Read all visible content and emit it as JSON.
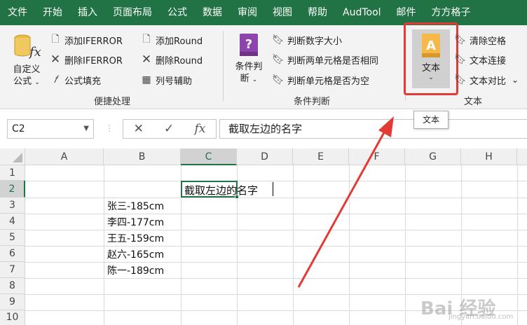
{
  "menu": [
    "文件",
    "开始",
    "插入",
    "页面布局",
    "公式",
    "数据",
    "审阅",
    "视图",
    "帮助",
    "AudTool",
    "邮件",
    "方方格子"
  ],
  "ribbon": {
    "custom_formula": {
      "line1": "自定义",
      "line2": "公式"
    },
    "quick": {
      "add_iferror": "添加IFERROR",
      "del_iferror": "删除IFERROR",
      "fill_formula": "公式填充",
      "add_round": "添加Round",
      "del_round": "删除Round",
      "col_helper": "列号辅助",
      "group_label": "便捷处理"
    },
    "condition": {
      "btn_line1": "条件判",
      "btn_line2": "断",
      "judge_size": "判断数字大小",
      "judge_same": "判断两单元格是否相同",
      "judge_empty": "判断单元格是否为空",
      "group_label": "条件判断"
    },
    "text": {
      "btn_label": "文本",
      "clear_space": "清除空格",
      "text_concat": "文本连接",
      "text_compare": "文本对比",
      "group_label": "文本"
    },
    "highlight_color": "#e53935",
    "accent_color": "#217346"
  },
  "tooltip": "文本",
  "formula_bar": {
    "name_box": "C2",
    "cancel_symbol": "✕",
    "confirm_symbol": "✓",
    "fx_symbol": "fx",
    "content": "截取左边的名字"
  },
  "grid": {
    "columns": [
      "A",
      "B",
      "C",
      "D",
      "E",
      "F",
      "G",
      "H"
    ],
    "rows": [
      "1",
      "2",
      "3",
      "4",
      "5",
      "6",
      "7",
      "8",
      "9",
      "10"
    ],
    "active_cell": "C2",
    "cells": {
      "c2": "截取左边的名字",
      "b3": "张三-185cm",
      "b4": "李四-177cm",
      "b5": "王五-159cm",
      "b6": "赵六-165cm",
      "b7": "陈一-189cm"
    }
  },
  "watermark": {
    "main": "Bai 经验",
    "sub": "jingyan.baidu.com"
  }
}
